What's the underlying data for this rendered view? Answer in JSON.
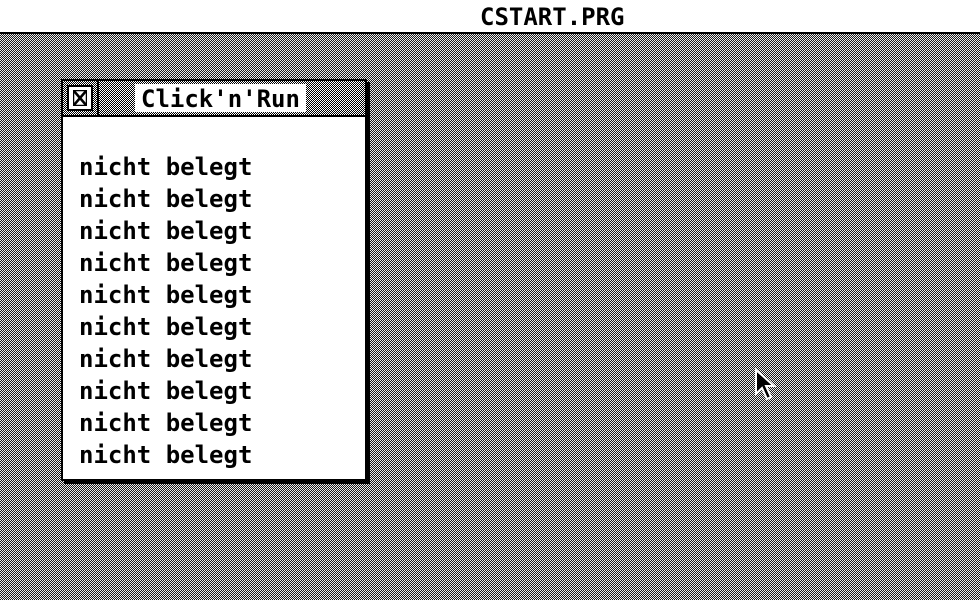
{
  "menubar": {
    "title": "CSTART.PRG"
  },
  "window": {
    "title": "Click'n'Run",
    "close_icon": "close-x-icon",
    "items": [
      {
        "label": "nicht belegt"
      },
      {
        "label": "nicht belegt"
      },
      {
        "label": "nicht belegt"
      },
      {
        "label": "nicht belegt"
      },
      {
        "label": "nicht belegt"
      },
      {
        "label": "nicht belegt"
      },
      {
        "label": "nicht belegt"
      },
      {
        "label": "nicht belegt"
      },
      {
        "label": "nicht belegt"
      },
      {
        "label": "nicht belegt"
      }
    ]
  },
  "pointer": {
    "icon": "mouse-pointer-icon"
  },
  "colors": {
    "foreground": "#000000",
    "background": "#ffffff"
  }
}
